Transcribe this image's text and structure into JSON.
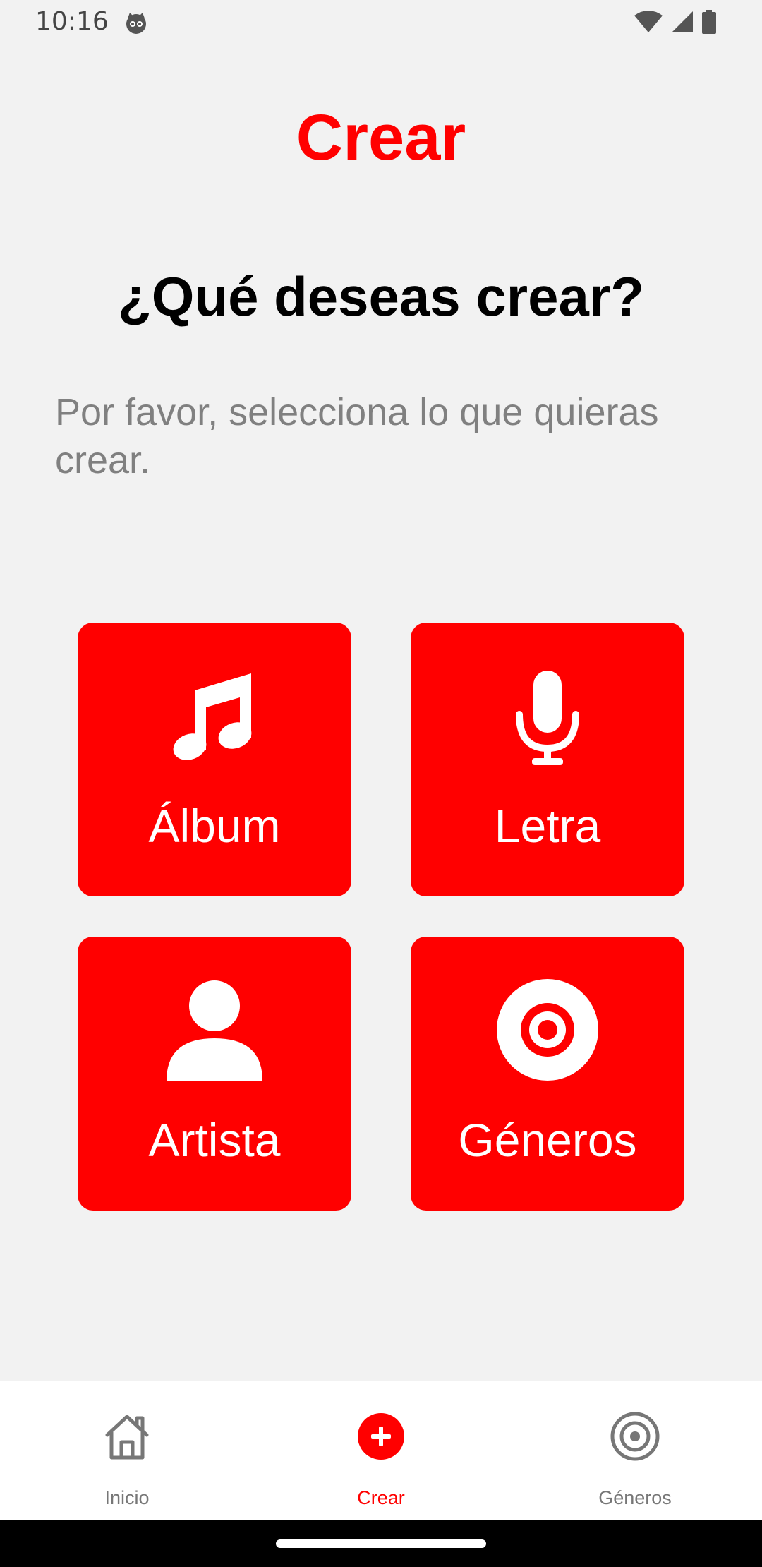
{
  "status_bar": {
    "time": "10:16",
    "icons": [
      "cat-app-icon",
      "wifi-icon",
      "signal-icon",
      "battery-icon"
    ]
  },
  "header": {
    "title": "Crear"
  },
  "main": {
    "question": "¿Qué deseas crear?",
    "instructions": "Por favor, selecciona lo que quieras crear.",
    "options": [
      {
        "label": "Álbum",
        "icon": "music-note-icon"
      },
      {
        "label": "Letra",
        "icon": "microphone-icon"
      },
      {
        "label": "Artista",
        "icon": "person-icon"
      },
      {
        "label": "Géneros",
        "icon": "target-icon"
      }
    ]
  },
  "bottom_nav": {
    "items": [
      {
        "label": "Inicio",
        "icon": "home-icon",
        "active": false
      },
      {
        "label": "Crear",
        "icon": "plus-circle-icon",
        "active": true
      },
      {
        "label": "Géneros",
        "icon": "target-icon",
        "active": false
      }
    ]
  },
  "colors": {
    "accent": "#ff0000",
    "background": "#f2f2f2",
    "muted_text": "#808080",
    "nav_inactive": "#777777"
  }
}
